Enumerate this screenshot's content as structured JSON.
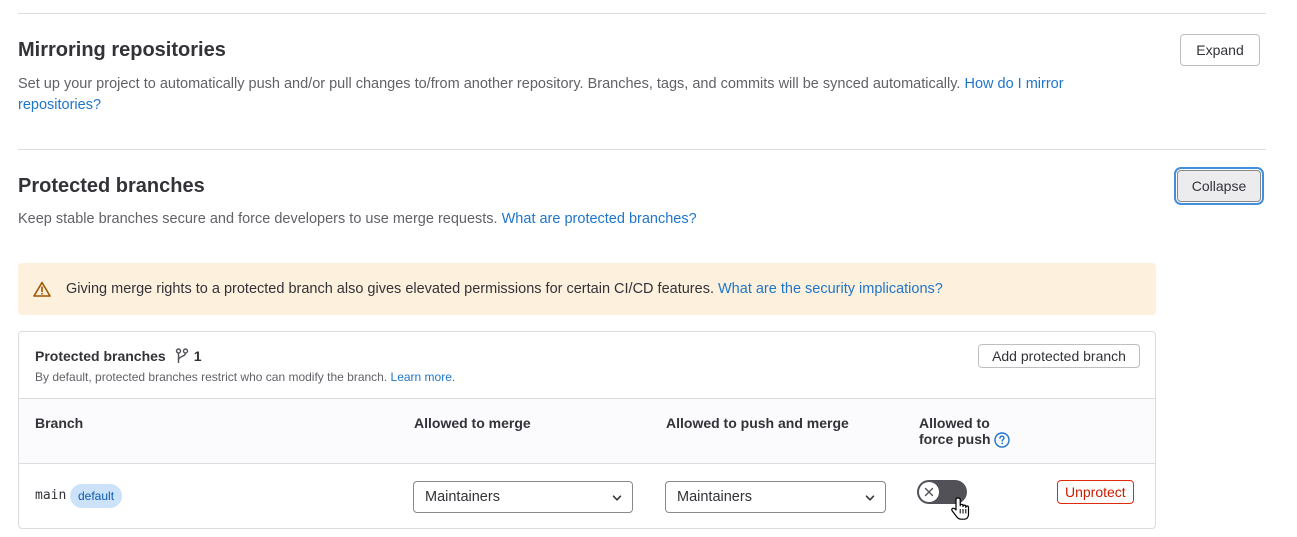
{
  "mirroring": {
    "title": "Mirroring repositories",
    "description": "Set up your project to automatically push and/or pull changes to/from another repository. Branches, tags, and commits will be synced automatically.",
    "help_link_1": "How do I mirror",
    "help_link_2": "repositories?",
    "expand_label": "Expand"
  },
  "protected": {
    "title": "Protected branches",
    "description": "Keep stable branches secure and force developers to use merge requests.",
    "help_link": "What are protected branches?",
    "collapse_label": "Collapse"
  },
  "alert": {
    "text": "Giving merge rights to a protected branch also gives elevated permissions for certain CI/CD features.",
    "link": "What are the security implications?",
    "icon": "warning-icon"
  },
  "card": {
    "title": "Protected branches",
    "count": "1",
    "subtitle": "By default, protected branches restrict who can modify the branch.",
    "learn_more": "Learn more.",
    "add_button": "Add protected branch"
  },
  "table": {
    "headers": {
      "branch": "Branch",
      "merge": "Allowed to merge",
      "push": "Allowed to push and merge",
      "force_1": "Allowed to",
      "force_2": "force push"
    },
    "rows": [
      {
        "branch": "main",
        "badge": "default",
        "merge": "Maintainers",
        "push": "Maintainers",
        "force_push_enabled": false,
        "unprotect": "Unprotect"
      }
    ]
  },
  "colors": {
    "link": "#1f75cb",
    "alert_bg": "#fdf1dd",
    "danger": "#dd2b0e",
    "badge_bg": "#cbe2f9"
  }
}
